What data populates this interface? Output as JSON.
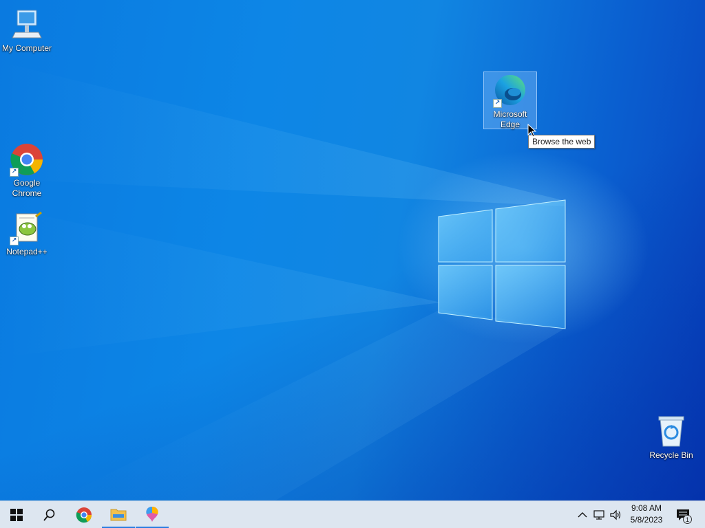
{
  "desktop": {
    "icons": [
      {
        "id": "my-computer",
        "label": "My Computer"
      },
      {
        "id": "google-chrome",
        "label": "Google Chrome"
      },
      {
        "id": "notepad-plus-plus",
        "label": "Notepad++"
      },
      {
        "id": "microsoft-edge",
        "label": "Microsoft Edge",
        "selected": true
      },
      {
        "id": "recycle-bin",
        "label": "Recycle Bin"
      }
    ],
    "tooltip": "Browse the web"
  },
  "taskbar": {
    "buttons": [
      {
        "id": "start",
        "icon": "windows-logo-icon"
      },
      {
        "id": "search",
        "icon": "search-icon"
      },
      {
        "id": "chrome",
        "icon": "chrome-icon"
      },
      {
        "id": "file-explorer",
        "icon": "folder-icon",
        "active": true
      },
      {
        "id": "paint-3d",
        "icon": "paint-icon",
        "active": true
      }
    ],
    "tray": {
      "icons": [
        "chevron-up-icon",
        "network-icon",
        "volume-icon"
      ],
      "time": "9:08 AM",
      "date": "5/8/2023",
      "notifications_count": "1"
    }
  },
  "colors": {
    "desktop_blue": "#0a7ae0",
    "taskbar_bg": "#dde6f0",
    "taskbar_active": "#2a7de0"
  }
}
